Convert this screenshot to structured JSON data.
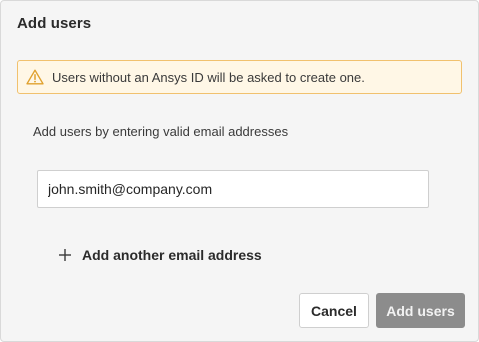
{
  "dialog": {
    "title": "Add users",
    "warning": {
      "icon": "warning-triangle-icon",
      "text": "Users without an Ansys ID will be asked to create one.",
      "border_color": "#f1c16e",
      "background_color": "#fff7e6",
      "icon_color": "#e0a12e"
    },
    "instructions": "Add users by entering valid email addresses",
    "email_field": {
      "value": "john.smith@company.com",
      "placeholder": ""
    },
    "add_another": {
      "icon": "plus-icon",
      "label": "Add another email address"
    },
    "buttons": {
      "cancel_label": "Cancel",
      "add_users_label": "Add users",
      "add_users_color": "#8c8c8c"
    }
  }
}
